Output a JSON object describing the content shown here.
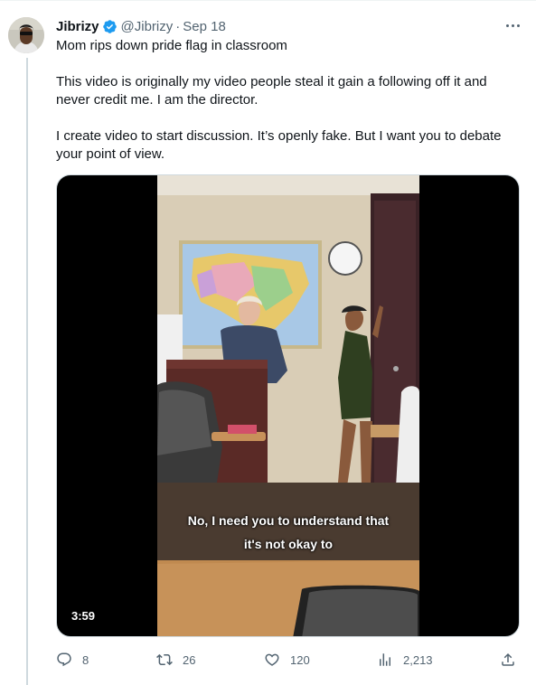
{
  "tweet": {
    "author": {
      "display_name": "Jibrizy",
      "handle": "@Jibrizy",
      "verified": true
    },
    "separator": "·",
    "date": "Sep 18",
    "text_lines": [
      "Mom rips down pride flag in classroom",
      "This video is originally my video people steal it gain a following off it and never credit me. I am the director.",
      "I create video to start discussion. It’s openly fake. But I want you to debate your point of view."
    ],
    "media": {
      "type": "video",
      "caption_lines": [
        "No, I need you to understand that",
        "it's not okay to"
      ],
      "duration": "3:59"
    },
    "metrics": {
      "replies": "8",
      "reposts": "26",
      "likes": "120",
      "views": "2,213"
    }
  },
  "colors": {
    "text_primary": "#0f1419",
    "text_secondary": "#536471",
    "verified_blue": "#1d9bf0",
    "thread_line": "#cfd9de"
  },
  "icons": [
    "verified-badge-icon",
    "more-icon",
    "reply-icon",
    "repost-icon",
    "like-icon",
    "views-icon",
    "share-icon"
  ]
}
